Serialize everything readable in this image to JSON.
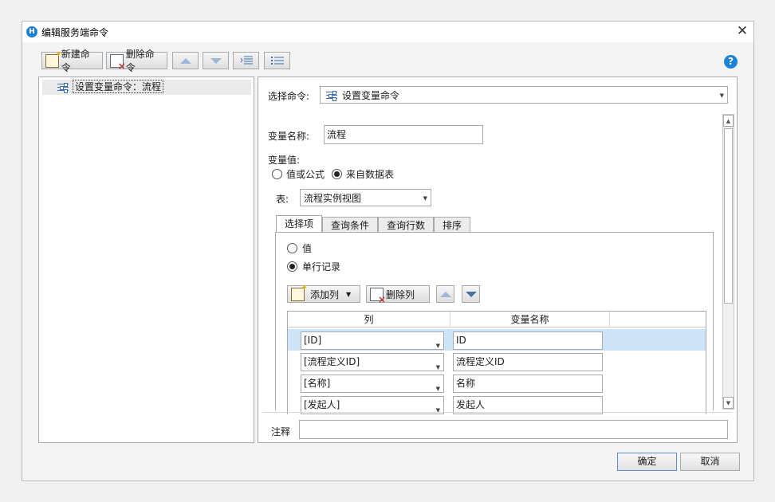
{
  "window": {
    "title": "编辑服务端命令",
    "app_icon": "H",
    "close_glyph": "✕"
  },
  "toolbar": {
    "new_label": "新建命令",
    "delete_label": "删除命令",
    "help_glyph": "?"
  },
  "tree": {
    "items": [
      {
        "label": "设置变量命令：流程"
      }
    ]
  },
  "form": {
    "select_command_label": "选择命令:",
    "select_command_value": "设置变量命令",
    "var_name_label": "变量名称:",
    "var_name_value": "流程",
    "var_value_label": "变量值:",
    "radio_formula": "值或公式",
    "radio_table": "来自数据表",
    "table_label": "表:",
    "table_value": "流程实例视图",
    "tabs": [
      "选择项",
      "查询条件",
      "查询行数",
      "排序"
    ],
    "radio_value": "值",
    "radio_single_row": "单行记录",
    "add_column": "添加列",
    "delete_column": "删除列",
    "grid_headers": {
      "col": "列",
      "var_name": "变量名称"
    },
    "grid_rows": [
      {
        "col": "[ID]",
        "name": "ID"
      },
      {
        "col": "[流程定义ID]",
        "name": "流程定义ID"
      },
      {
        "col": "[名称]",
        "name": "名称"
      },
      {
        "col": "[发起人]",
        "name": "发起人"
      }
    ],
    "note_label": "注释",
    "note_value": ""
  },
  "footer": {
    "ok": "确定",
    "cancel": "取消"
  },
  "colors": {
    "accent": "#1b84d8",
    "selected_row": "#cde3f8",
    "arrow": "#9fb6d8"
  }
}
